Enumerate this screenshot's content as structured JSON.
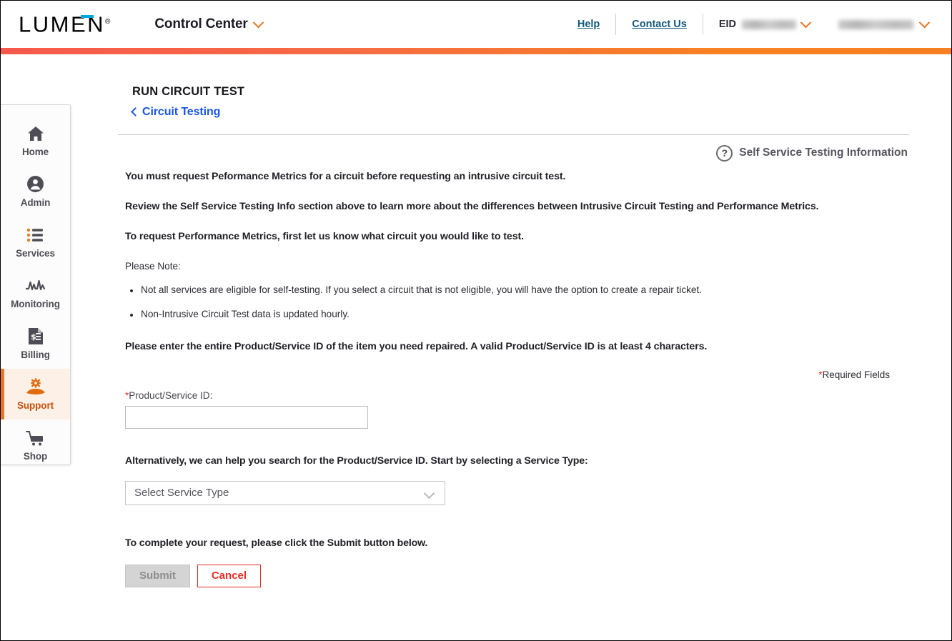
{
  "header": {
    "logo": "LUMEN",
    "logo_registered": "®",
    "app_title": "Control Center",
    "help_label": "Help",
    "contact_label": "Contact Us",
    "eid_label": "EID",
    "eid_value": "",
    "account_value": ""
  },
  "sidebar": {
    "items": [
      {
        "label": "Home",
        "icon": "home-icon",
        "active": false
      },
      {
        "label": "Admin",
        "icon": "user-circle-icon",
        "active": false
      },
      {
        "label": "Services",
        "icon": "list-icon",
        "active": false
      },
      {
        "label": "Monitoring",
        "icon": "waveform-icon",
        "active": false
      },
      {
        "label": "Billing",
        "icon": "invoice-dollar-icon",
        "active": false
      },
      {
        "label": "Support",
        "icon": "hand-gear-icon",
        "active": true
      },
      {
        "label": "Shop",
        "icon": "cart-icon",
        "active": false
      }
    ]
  },
  "main": {
    "page_title": "RUN CIRCUIT TEST",
    "breadcrumb": "Circuit Testing",
    "info_link": "Self Service Testing Information",
    "info_icon": "question-circle-icon",
    "lead_lines": [
      "You must request Peformance Metrics for a circuit before requesting an intrusive circuit test.",
      "Review the Self Service Testing Info section above to learn more about the differences between Intrusive Circuit Testing and Performance Metrics.",
      "To request Performance Metrics, first let us know what circuit you would like to test."
    ],
    "note_heading": "Please Note:",
    "notes": [
      "Not all services are eligible for self-testing. If you select a circuit that is not eligible, you will have the option to create a repair ticket.",
      "Non-Intrusive Circuit Test data is updated hourly."
    ],
    "instruction": "Please enter the entire Product/Service ID of the item you need repaired. A valid Product/Service ID is at least 4 characters.",
    "required_note": "Required Fields",
    "required_star": "*",
    "product_label": "Product/Service ID:",
    "product_value": "",
    "product_placeholder": "",
    "alt_text": "Alternatively, we can help you search for the Product/Service ID. Start by selecting a Service Type:",
    "service_type_selected": "Select Service Type",
    "complete_text": "To complete your request, please click the Submit button below.",
    "submit_label": "Submit",
    "cancel_label": "Cancel"
  },
  "colors": {
    "brand_orange": "#E87722",
    "brand_red": "#F7594C",
    "link_blue": "#1A55E8",
    "header_link": "#13597A",
    "cancel_red": "#E53027",
    "active_bg": "#FDF0E6"
  }
}
